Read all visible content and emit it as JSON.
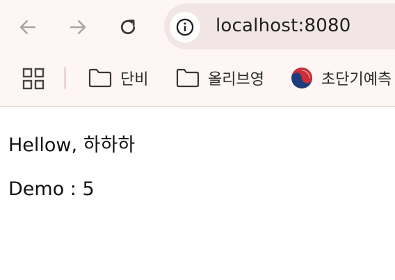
{
  "address_bar": {
    "url": "localhost:8080"
  },
  "bookmarks": [
    {
      "label": "단비",
      "icon": "folder-icon"
    },
    {
      "label": "올리브영",
      "icon": "folder-icon"
    },
    {
      "label": "초단기예측",
      "icon": "korea-emblem-icon"
    }
  ],
  "page": {
    "greeting": "Hellow, 하하하",
    "demo": "Demo : 5"
  },
  "colors": {
    "toolbar_bg": "#fdf6f4",
    "omnibox_bg": "#f1e5e6",
    "page_bg": "#ffffff"
  }
}
